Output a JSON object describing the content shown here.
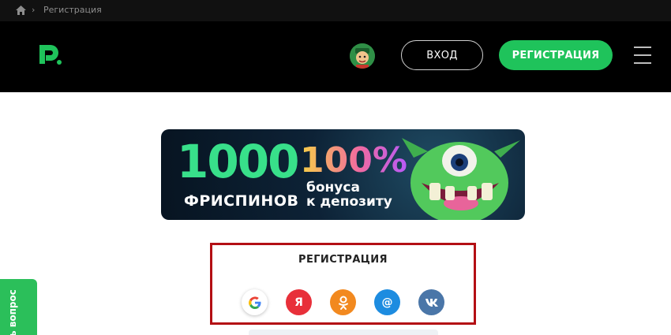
{
  "breadcrumb": {
    "home_icon": "home-icon",
    "separator": "›",
    "current": "Регистрация"
  },
  "header": {
    "logo_icon": "pokerdom-logo-icon",
    "avatar_icon": "avatar-icon",
    "login_label": "ВХОД",
    "register_label": "РЕГИСТРАЦИЯ",
    "menu_icon": "hamburger-icon"
  },
  "banner": {
    "spins_count": "1000",
    "spins_label": "ФРИСПИНОВ",
    "bonus_percent": "100%",
    "bonus_line1": "бонуса",
    "bonus_line2": "к депозиту"
  },
  "registration": {
    "title": "РЕГИСТРАЦИЯ",
    "social": [
      {
        "name": "google",
        "glyph": "G"
      },
      {
        "name": "yandex",
        "glyph": "Я"
      },
      {
        "name": "odnoklassniki",
        "glyph": "ok"
      },
      {
        "name": "mail-ru",
        "glyph": "@"
      },
      {
        "name": "vk",
        "glyph": "vk"
      }
    ]
  },
  "ask_tab": {
    "label": "ь вопрос"
  },
  "colors": {
    "brand_green": "#1fc35b",
    "highlight_border": "#b30f14",
    "header_bg": "#000000"
  }
}
